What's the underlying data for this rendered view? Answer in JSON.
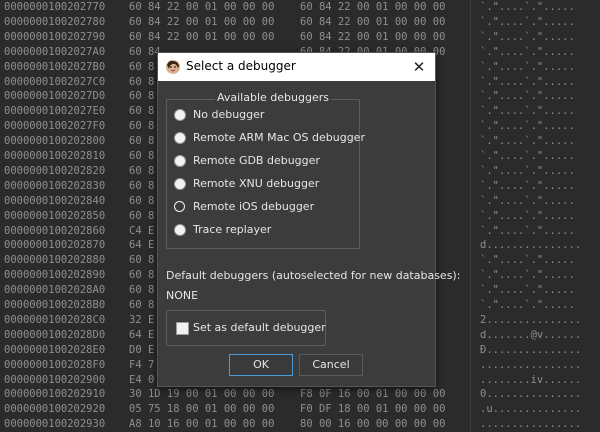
{
  "hex": {
    "rows": [
      {
        "addr": "0000000100202770",
        "b1": "60 84 22 00 01 00 00 00",
        "b2": "60 84 22 00 01 00 00 00",
        "ascii": "`.\"....`.\"....."
      },
      {
        "addr": "0000000100202780",
        "b1": "60 84 22 00 01 00 00 00",
        "b2": "60 84 22 00 01 00 00 00",
        "ascii": "`.\"....`.\"....."
      },
      {
        "addr": "0000000100202790",
        "b1": "60 84 22 00 01 00 00 00",
        "b2": "60 84 22 00 01 00 00 00",
        "ascii": "`.\"....`.\"....."
      },
      {
        "addr": "00000001002027A0",
        "b1": "60 84",
        "b2": "60 84 22 00 01 00 00 00",
        "ascii": "`.\"....`.\"....."
      },
      {
        "addr": "00000001002027B0",
        "b1": "60 8",
        "b2": "",
        "ascii": "`.\"....`.\"....."
      },
      {
        "addr": "00000001002027C0",
        "b1": "60 8",
        "b2": "",
        "ascii": "`.\"....`.\"....."
      },
      {
        "addr": "00000001002027D0",
        "b1": "60 8",
        "b2": "",
        "ascii": "`.\"....`.\"....."
      },
      {
        "addr": "00000001002027E0",
        "b1": "60 8",
        "b2": "",
        "ascii": "`.\"....`.\"....."
      },
      {
        "addr": "00000001002027F0",
        "b1": "60 8",
        "b2": "",
        "ascii": "`.\"....`.\"....."
      },
      {
        "addr": "0000000100202800",
        "b1": "60 8",
        "b2": "",
        "ascii": "`.\"....`.\"....."
      },
      {
        "addr": "0000000100202810",
        "b1": "60 8",
        "b2": "",
        "ascii": "`.\"....`.\"....."
      },
      {
        "addr": "0000000100202820",
        "b1": "60 8",
        "b2": "",
        "ascii": "`.\"....`.\"....."
      },
      {
        "addr": "0000000100202830",
        "b1": "60 8",
        "b2": "",
        "ascii": "`.\"....`.\"....."
      },
      {
        "addr": "0000000100202840",
        "b1": "60 8",
        "b2": "",
        "ascii": "`.\"....`.\"....."
      },
      {
        "addr": "0000000100202850",
        "b1": "60 8",
        "b2": "",
        "ascii": "`.\"....`.\"....."
      },
      {
        "addr": "0000000100202860",
        "b1": "C4 E",
        "b2": "",
        "ascii": "`.\"....`.\"....."
      },
      {
        "addr": "0000000100202870",
        "b1": "64 E",
        "b2": "",
        "ascii": "d..............."
      },
      {
        "addr": "0000000100202880",
        "b1": "60 8",
        "b2": "",
        "ascii": "`.\"....`.\"....."
      },
      {
        "addr": "0000000100202890",
        "b1": "60 8",
        "b2": "",
        "ascii": "`.\"....`.\"....."
      },
      {
        "addr": "00000001002028A0",
        "b1": "60 8",
        "b2": "",
        "ascii": "`.\"....`.\"....."
      },
      {
        "addr": "00000001002028B0",
        "b1": "60 8",
        "b2": "",
        "ascii": "`.\"....`.\"....."
      },
      {
        "addr": "00000001002028C0",
        "b1": "32 E",
        "b2": "",
        "ascii": "2..............."
      },
      {
        "addr": "00000001002028D0",
        "b1": "64 E",
        "b2": "",
        "ascii": "d.......@v......"
      },
      {
        "addr": "00000001002028E0",
        "b1": "D0 E",
        "b2": "",
        "ascii": "Ð..............."
      },
      {
        "addr": "00000001002028F0",
        "b1": "F4 7",
        "b2": "",
        "ascii": "................"
      },
      {
        "addr": "0000000100202900",
        "b1": "E4 0",
        "b2": "",
        "ascii": "........iv......"
      },
      {
        "addr": "0000000100202910",
        "b1": "30 1D 19 00 01 00 00 00",
        "b2": "F8 0F 16 00 01 00 00 00",
        "ascii": "0..............."
      },
      {
        "addr": "0000000100202920",
        "b1": "05 75 18 00 01 00 00 00",
        "b2": "F0 DF 18 00 01 00 00 00",
        "ascii": ".u.............."
      },
      {
        "addr": "0000000100202930",
        "b1": "A8 10 16 00 01 00 00 00",
        "b2": "80 00 16 00 00 00 00 00",
        "ascii": "................"
      }
    ]
  },
  "dialog": {
    "title": "Select a debugger",
    "close_label": "✕",
    "group_title": "Available debuggers",
    "options": [
      {
        "label": "No debugger",
        "selected": false
      },
      {
        "label": "Remote ARM Mac OS debugger",
        "selected": false
      },
      {
        "label": "Remote GDB debugger",
        "selected": false
      },
      {
        "label": "Remote XNU debugger",
        "selected": false
      },
      {
        "label": "Remote iOS debugger",
        "selected": true
      },
      {
        "label": "Trace replayer",
        "selected": false
      }
    ],
    "default_label": "Default debuggers (autoselected for new databases):",
    "default_value": "NONE",
    "checkbox_label": "Set as default debugger",
    "checkbox_checked": false,
    "ok_label": "OK",
    "cancel_label": "Cancel"
  }
}
